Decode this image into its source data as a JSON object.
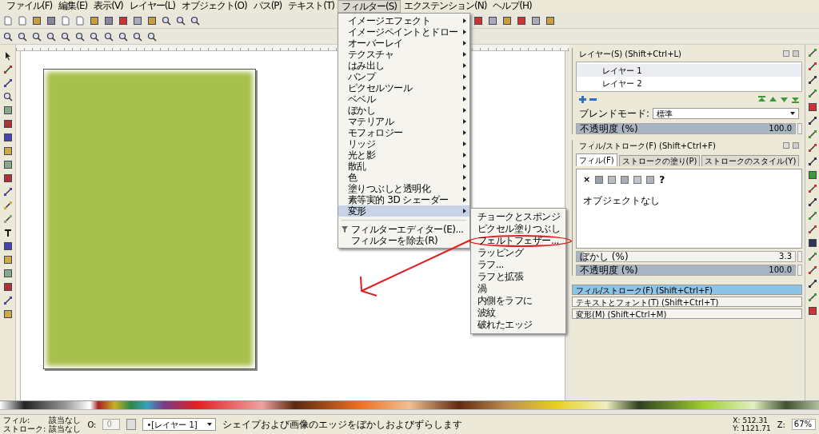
{
  "menu_bar": [
    {
      "label": "ファイル(F)",
      "selected": false
    },
    {
      "label": "編集(E)",
      "selected": false
    },
    {
      "label": "表示(V)",
      "selected": false
    },
    {
      "label": "レイヤー(L)",
      "selected": false
    },
    {
      "label": "オブジェクト(O)",
      "selected": false
    },
    {
      "label": "パス(P)",
      "selected": false
    },
    {
      "label": "テキスト(T)",
      "selected": false
    },
    {
      "label": "フィルター(S)",
      "selected": true
    },
    {
      "label": "エクステンション(N)",
      "selected": false
    },
    {
      "label": "ヘルプ(H)",
      "selected": false
    }
  ],
  "filters_menu": [
    {
      "label": "イメージエフェクト",
      "selected": false
    },
    {
      "label": "イメージペイントとドロー",
      "selected": false
    },
    {
      "label": "オーバーレイ",
      "selected": false
    },
    {
      "label": "テクスチャ",
      "selected": false
    },
    {
      "label": "はみ出し",
      "selected": false
    },
    {
      "label": "バンプ",
      "selected": false
    },
    {
      "label": "ピクセルツール",
      "selected": false
    },
    {
      "label": "ベベル",
      "selected": false
    },
    {
      "label": "ぼかし",
      "selected": false
    },
    {
      "label": "マテリアル",
      "selected": false
    },
    {
      "label": "モフォロジー",
      "selected": false
    },
    {
      "label": "リッジ",
      "selected": false
    },
    {
      "label": "光と影",
      "selected": false
    },
    {
      "label": "散乱",
      "selected": false
    },
    {
      "label": "色",
      "selected": false
    },
    {
      "label": "塗りつぶしと透明化",
      "selected": false
    },
    {
      "label": "素等実的 3D シェーダー",
      "selected": false
    },
    {
      "label": "変形",
      "selected": true
    }
  ],
  "filters_commands": [
    {
      "label": "フィルターエディター(E)...",
      "kind": "editor"
    },
    {
      "label": "フィルターを除去(R)",
      "kind": "plain"
    }
  ],
  "submenu": [
    {
      "label": "チョークとスポンジ",
      "circled": false
    },
    {
      "label": "ピクセル塗りつぶし",
      "circled": false
    },
    {
      "label": "フェルトフェザー...",
      "circled": true
    },
    {
      "label": "ラッピング",
      "circled": false
    },
    {
      "label": "ラフ...",
      "circled": false
    },
    {
      "label": "ラフと拡張",
      "circled": false
    },
    {
      "label": "渦",
      "circled": false
    },
    {
      "label": "内側をラフに",
      "circled": false
    },
    {
      "label": "波紋",
      "circled": false
    },
    {
      "label": "破れたエッジ",
      "circled": false
    }
  ],
  "layers_panel": {
    "title": "レイヤー(S) (Shift+Ctrl+L)",
    "layers": [
      {
        "name": "レイヤー 1",
        "selected": true
      },
      {
        "name": "レイヤー 2",
        "selected": false
      }
    ],
    "blend_label": "ブレンドモード:",
    "blend_value": "標準",
    "opacity": {
      "label": "不透明度 (%)",
      "value": "100.0",
      "level": 1
    }
  },
  "fill_stroke_panel": {
    "title": "フィル/ストローク(F) (Shift+Ctrl+F)",
    "tabs": [
      {
        "label": "フィル(F)",
        "selected": true
      },
      {
        "label": "ストロークの塗り(P)",
        "selected": false
      },
      {
        "label": "ストロークのスタイル(Y)",
        "selected": false
      }
    ],
    "no_paint": "×",
    "unset_paint": "?",
    "no_object": "オブジェクトなし",
    "blur": {
      "label": "ぼかし (%)",
      "value": "3.3",
      "level": 0.033
    },
    "opacity": {
      "label": "不透明度 (%)",
      "value": "100.0",
      "level": 1
    }
  },
  "docks": [
    {
      "label": "フィル/ストローク(F) (Shift+Ctrl+F)",
      "selected": true
    },
    {
      "label": "テキストとフォント(T) (Shift+Ctrl+T)",
      "selected": false
    },
    {
      "label": "変形(M) (Shift+Ctrl+M)",
      "selected": false
    }
  ],
  "status_bar": {
    "fill_label": "フィル:",
    "fill_value": "該当なし",
    "stroke_label": "ストローク:",
    "stroke_value": "該当なし",
    "opacity_label": "O:",
    "opacity_value": "0",
    "layer": "•[レイヤー 1]",
    "message": "シェイプおよび画像のエッジをぼかしおよびずらします",
    "x": "X: 512.31",
    "y": "Y: 1121.71",
    "zoom_label": "Z:",
    "zoom_value": "67%"
  }
}
